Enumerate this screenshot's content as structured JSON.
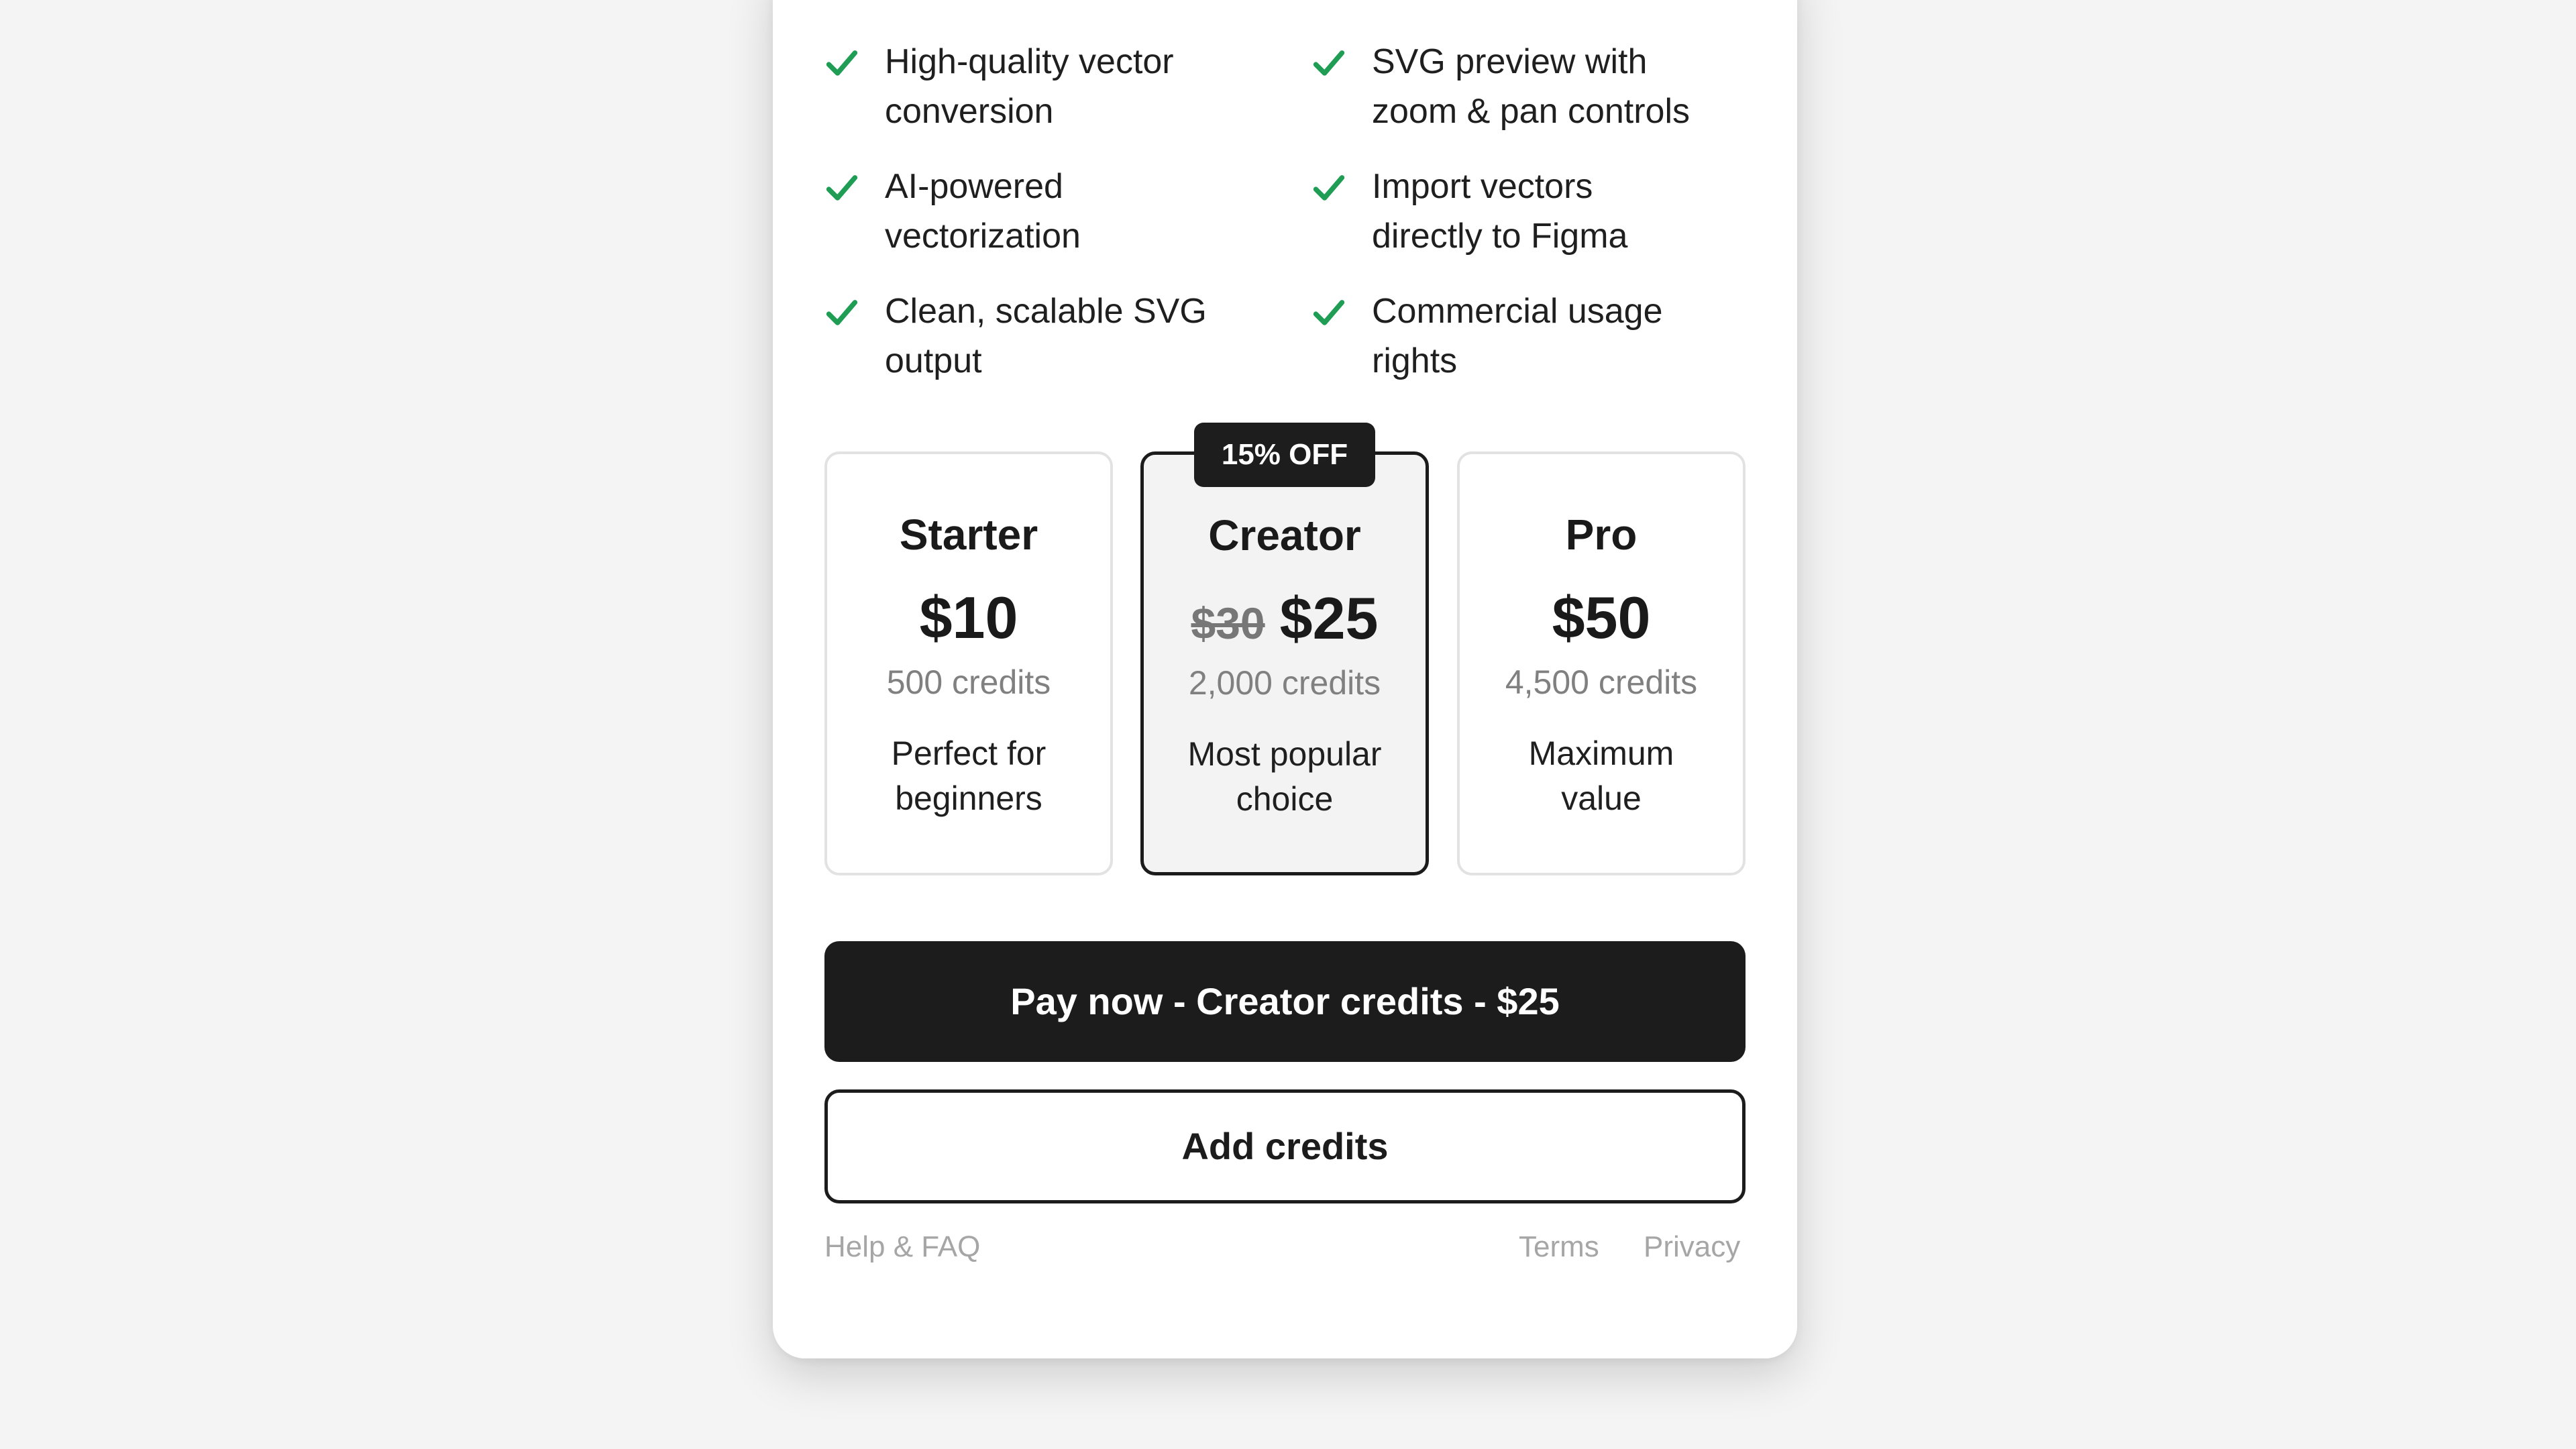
{
  "features": [
    "High-quality vector\nconversion",
    "SVG preview with\nzoom & pan controls",
    "AI-powered\nvectorization",
    "Import vectors\ndirectly to Figma",
    "Clean, scalable SVG\noutput",
    "Commercial usage\nrights"
  ],
  "check_icon": "check-icon",
  "accent_color": "#1f9d55",
  "plans": [
    {
      "name": "Starter",
      "old_price": "",
      "price": "$10",
      "credits": "500 credits",
      "description": "Perfect for\nbeginners",
      "badge": "",
      "selected": false
    },
    {
      "name": "Creator",
      "old_price": "$30",
      "price": "$25",
      "credits": "2,000 credits",
      "description": "Most popular\nchoice",
      "badge": "15% OFF",
      "selected": true
    },
    {
      "name": "Pro",
      "old_price": "",
      "price": "$50",
      "credits": "4,500 credits",
      "description": "Maximum\nvalue",
      "badge": "",
      "selected": false
    }
  ],
  "pay_button": "Pay now - Creator credits - $25",
  "add_credits_button": "Add credits",
  "footer": {
    "help": "Help & FAQ",
    "terms": "Terms",
    "privacy": "Privacy"
  }
}
